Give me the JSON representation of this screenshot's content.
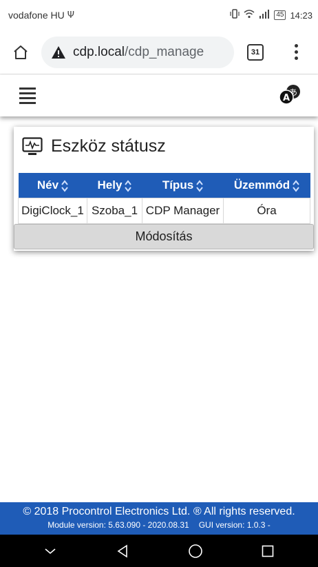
{
  "status_bar": {
    "carrier": "vodafone HU",
    "usb_symbol": "Ψ",
    "battery": "45",
    "time": "14:23"
  },
  "browser": {
    "url_host": "cdp.local",
    "url_path": "/cdp_manage",
    "tab_count": "31"
  },
  "card": {
    "title": "Eszköz státusz",
    "columns": [
      "Név",
      "Hely",
      "Típus",
      "Üzemmód"
    ],
    "rows": [
      [
        "DigiClock_1",
        "Szoba_1",
        "CDP Manager",
        "Óra"
      ]
    ],
    "button_label": "Módosítás"
  },
  "footer": {
    "copyright": "© 2018 Procontrol Electronics Ltd. ® All rights reserved.",
    "module_version": "Module version: 5.63.090 - 2020.08.31",
    "gui_version": "GUI version: 1.0.3 -"
  },
  "colors": {
    "accent": "#1f5cb7",
    "button_bg": "#d9d9d9"
  },
  "icons": {
    "home": "home-icon",
    "warning": "warning-icon",
    "menu": "more-vert-icon",
    "hamburger": "hamburger-menu-icon",
    "language": "language-icon",
    "monitor": "monitor-icon",
    "sort": "sort-icon"
  }
}
